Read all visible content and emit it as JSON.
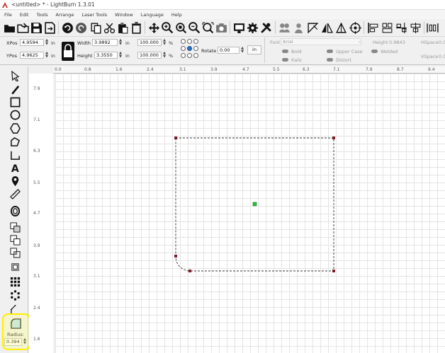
{
  "window": {
    "title": "<untitled> * - LightBurn 1.3.01"
  },
  "menu": [
    "File",
    "Edit",
    "Tools",
    "Arrange",
    "Laser Tools",
    "Window",
    "Language",
    "Help"
  ],
  "toolbar_icons": [
    "open-icon",
    "import-icon",
    "save-icon",
    "export-icon",
    "undo-icon",
    "redo-icon",
    "copy-icon",
    "cut-icon",
    "paste-icon",
    "delete-icon",
    "move-icon",
    "zoom-in-icon",
    "zoom-frame-icon",
    "zoom-out-icon",
    "camera-icon",
    "monitor-icon",
    "settings-icon",
    "tools-icon",
    "group-icon",
    "ungroup-icon",
    "mirror-h-icon",
    "mirror-v-icon",
    "rotate-icon",
    "align-left-icon",
    "align-center-icon",
    "align-right-icon",
    "distribute-icon"
  ],
  "props": {
    "xpos_label": "XPos",
    "xpos": "4.9594",
    "xpos_unit": "in",
    "ypos_label": "YPos",
    "ypos": "4.9625",
    "ypos_unit": "in",
    "width_label": "Width",
    "width": "3.9892",
    "width_unit": "in",
    "height_label": "Height",
    "height": "3.3550",
    "height_unit": "in",
    "scale_w": "100.000",
    "scale_h": "100.000",
    "pct": "%",
    "rotate_label": "Rotate",
    "rotate": "0.00",
    "rotate_unit": "in",
    "font_label": "Font",
    "font_value": "Arial",
    "bold_label": "Bold",
    "italic_label": "Italic",
    "upper_label": "Upper Case",
    "welded_label": "Welded",
    "distort_label": "Distort",
    "text_height_label": "Height",
    "text_height": "0.9843",
    "hspace_label": "HSpace",
    "hspace": "0.0",
    "vspace_label": "VSpace",
    "vspace": "0.0"
  },
  "ruler": {
    "x_ticks": [
      "0.0",
      "0.8",
      "1.6",
      "2.4",
      "3.1",
      "3.9",
      "4.7",
      "5.5",
      "6.3",
      "7.1",
      "7.9",
      "8.7",
      "9.4"
    ],
    "y_ticks": [
      "7.9",
      "7.1",
      "6.3",
      "5.5",
      "4.7",
      "3.9",
      "3.1",
      "2.4",
      "1.6"
    ]
  },
  "left_tools": [
    "select-icon",
    "edit-nodes-icon",
    "rectangle-icon",
    "ellipse-icon",
    "polygon-icon",
    "polyline-icon",
    "draw-lines-icon",
    "text-icon",
    "position-laser-icon",
    "measure-icon",
    "offset-icon",
    "boolean-union-icon",
    "boolean-subtract-icon",
    "boolean-intersect-icon",
    "weld-icon",
    "grid-array-icon",
    "circular-array-icon",
    "convert-to-bitmap-icon",
    "corner-radius-icon"
  ],
  "radius": {
    "label": "Radius:",
    "value": "0.394"
  },
  "colors": {
    "accent": "#2b72c8",
    "highlight": "#ffee00",
    "node": "#7a1f2b",
    "center": "#2dbf3a"
  }
}
